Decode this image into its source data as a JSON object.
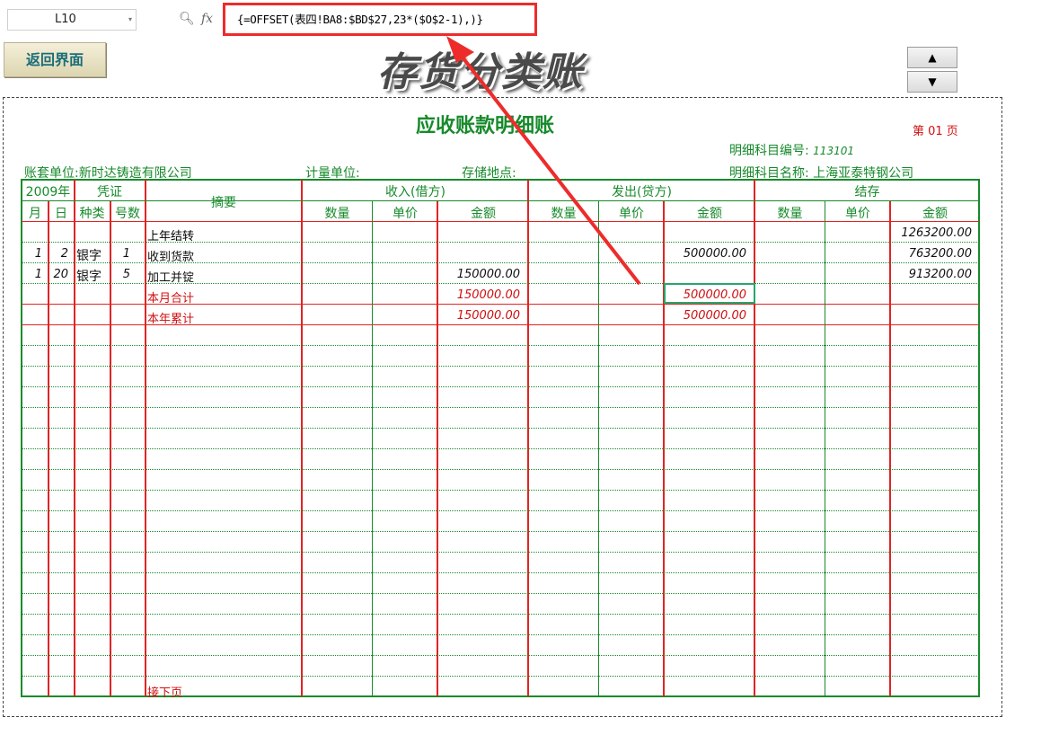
{
  "formula_bar": {
    "name_box": "L10",
    "fx": "fx",
    "formula": "{=OFFSET(表四!BA8:$BD$27,23*($O$2-1),)}"
  },
  "controls": {
    "back_button": "返回界面",
    "banner_title": "存货分类账",
    "up_symbol": "▲",
    "down_symbol": "▼"
  },
  "report": {
    "title": "应收账款明细账",
    "page": "第 01 页",
    "subject_code_label": "明细科目编号:",
    "subject_code": "113101",
    "company_label": "账套单位:新时达铸造有限公司",
    "unit_label": "计量单位:",
    "location_label": "存储地点:",
    "subject_name_label": "明细科目名称:",
    "subject_name": "上海亚泰特钢公司"
  },
  "headers": {
    "year": "2009年",
    "voucher": "凭证",
    "summary": "摘要",
    "income": "收入(借方)",
    "outgo": "发出(贷方)",
    "balance": "结存",
    "month": "月",
    "day": "日",
    "kind": "种类",
    "number": "号数",
    "qty": "数量",
    "price": "单价",
    "amount": "金额"
  },
  "rows": [
    {
      "month": "",
      "day": "",
      "kind": "",
      "no": "",
      "summary": "上年结转",
      "in_amt": "",
      "out_amt": "",
      "bal_amt": "1263200.00",
      "style": "red"
    },
    {
      "month": "1",
      "day": "2",
      "kind": "银字",
      "no": "1",
      "summary": "收到货款",
      "in_amt": "",
      "out_amt": "500000.00",
      "bal_amt": "763200.00",
      "style": "black"
    },
    {
      "month": "1",
      "day": "20",
      "kind": "银字",
      "no": "5",
      "summary": "加工并锭",
      "in_amt": "150000.00",
      "out_amt": "",
      "bal_amt": "913200.00",
      "style": "black"
    },
    {
      "month": "",
      "day": "",
      "kind": "",
      "no": "",
      "summary": "本月合计",
      "in_amt": "150000.00",
      "out_amt": "500000.00",
      "bal_amt": "",
      "style": "red"
    },
    {
      "month": "",
      "day": "",
      "kind": "",
      "no": "",
      "summary": "本年累计",
      "in_amt": "150000.00",
      "out_amt": "500000.00",
      "bal_amt": "",
      "style": "red"
    }
  ],
  "footer_row": "接下页",
  "colors": {
    "grid": "#178a2b",
    "accent_red": "#e02424",
    "annotation": "#ee2b2b"
  }
}
